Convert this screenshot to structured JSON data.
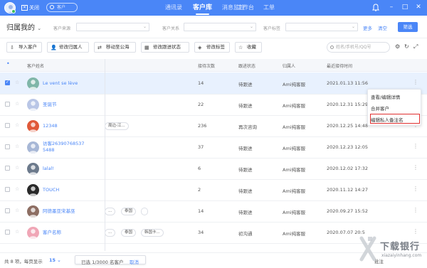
{
  "topbar": {
    "close_label": "关闭",
    "search_placeholder": "客户",
    "nav": [
      "通讯录",
      "客户库",
      "消息监控",
      "工作台",
      "工单"
    ],
    "active_nav": "客户库",
    "min_icon": "minimize-icon",
    "max_icon": "maximize-icon",
    "close_icon": "close-icon"
  },
  "filters": {
    "owner_label": "归属我的",
    "source_label": "客户来源",
    "relation_label": "客户关系",
    "tag_label": "客户标签",
    "more_label": "更多",
    "clear_label": "清空",
    "filter_button": "筛选"
  },
  "toolbar": {
    "import": "导入客户",
    "edit_owner": "修改归属人",
    "move_pool": "移动至公海",
    "edit_status": "修改跟进状态",
    "edit_tag": "修改标签",
    "favorite": "收藏",
    "search_placeholder": "姓名/手机号/QQ号"
  },
  "table": {
    "headers": {
      "name": "客户姓名",
      "count": "接待次数",
      "status": "跟进状态",
      "owner": "归属人",
      "last": "最近接待时间"
    },
    "rows": [
      {
        "name": "Le vent se lève",
        "tags": [],
        "count": "14",
        "status": "待跟进",
        "owner": "Ami纯客服",
        "last": "2021.01.13 11:56",
        "selected": true
      },
      {
        "name": "圣诞节",
        "tags": [],
        "count": "22",
        "status": "待跟进",
        "owner": "Ami纯客服",
        "last": "2020.12.31 15:29",
        "selected": false
      },
      {
        "name": "12348",
        "tags": [
          "周边-江..."
        ],
        "count": "236",
        "status": "再次咨询",
        "owner": "Ami纯客服",
        "last": "2020.12.25 14:48",
        "selected": false
      },
      {
        "name": "访客26390768537 5488",
        "tags": [],
        "count": "37",
        "status": "待跟进",
        "owner": "Ami纯客服",
        "last": "2020.12.23 12:05",
        "selected": false
      },
      {
        "name": "lalal!",
        "tags": [],
        "count": "6",
        "status": "待跟进",
        "owner": "Ami纯客服",
        "last": "2020.12.02 17:32",
        "selected": false
      },
      {
        "name": "TOUCH",
        "tags": [],
        "count": "2",
        "status": "待跟进",
        "owner": "Ami纯客服",
        "last": "2020.11.12 14:27",
        "selected": false
      },
      {
        "name": "阿德墨亚宋基巫",
        "tags": [
          "...",
          "泰国",
          ""
        ],
        "count": "14",
        "status": "待跟进",
        "owner": "Ami纯客服",
        "last": "2020.09.27 15:52",
        "selected": false
      },
      {
        "name": "客户名称",
        "tags": [
          "...",
          "泰国",
          "韩国卡..."
        ],
        "count": "34",
        "status": "初沟通",
        "owner": "Ami纯客服",
        "last": "2020.07.07 20:5",
        "selected": false
      }
    ]
  },
  "context_menu": {
    "items": [
      "查看/编辑详情",
      "合并客户",
      "编辑私人备注名"
    ],
    "highlighted": "编辑私人备注名"
  },
  "footer": {
    "total": "共 8 项，每页显示",
    "page_size": "15",
    "selected_info": "已选 1/3000 名客户",
    "cancel": "取消",
    "partial_label": "批注"
  },
  "watermark": {
    "brand": "下载银行",
    "url": "xiazaiyinhang.com"
  },
  "colors": {
    "primary": "#4a86f7",
    "highlight_border": "#e03030",
    "selected_row": "#e8f1fe"
  }
}
